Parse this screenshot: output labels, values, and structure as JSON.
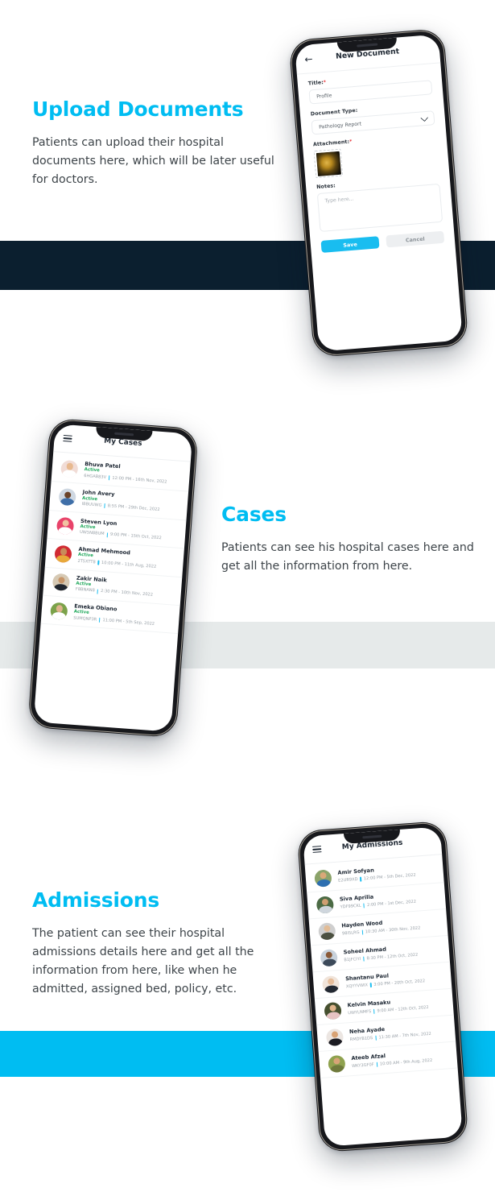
{
  "bands": {
    "dark": "#0b1f2f",
    "gray": "#e6eaea",
    "blue": "#00bdf2",
    "accent": "#00bdf2",
    "status_green": "#1fa85b"
  },
  "sections": [
    {
      "id": "upload",
      "heading": "Upload Documents",
      "body": "Patients can upload their hospital documents here, which will be later useful for doctors."
    },
    {
      "id": "cases",
      "heading": "Cases",
      "body": "Patients can see his hospital cases here and get all the information from here."
    },
    {
      "id": "admissions",
      "heading": "Admissions",
      "body": "The patient can see their hospital admissions details here and get all the information from here, like when he admitted, assigned bed, policy, etc."
    }
  ],
  "new_document": {
    "appbar": {
      "title": "New Document",
      "back_icon": "arrow-left-icon"
    },
    "title_label": "Title:",
    "title_required": "*",
    "title_value": "Profile",
    "doctype_label": "Document Type:",
    "doctype_value": "Pathology Report",
    "doctype_caret": "chevron-down-icon",
    "attachment_label": "Attachment:",
    "attachment_required": "*",
    "notes_label": "Notes:",
    "notes_placeholder": "Type here...",
    "save_label": "Save",
    "cancel_label": "Cancel"
  },
  "cases": {
    "appbar": {
      "title": "My Cases",
      "menu_icon": "hamburger-menu-icon"
    },
    "rows": [
      {
        "name": "Bhuva Patel",
        "status": "Active",
        "code": "6HGAB83V",
        "time": "12:00 PM",
        "date": "16th Nov, 2022",
        "skin": "#e8b98f",
        "shirt": "#ffffff",
        "bg": "#f1dcd6"
      },
      {
        "name": "John Avery",
        "status": "Active",
        "code": "IBBUUWG",
        "time": "8:55 PM",
        "date": "29th Dec, 2022",
        "skin": "#6b4328",
        "shirt": "#3f6fa8",
        "bg": "#cfd8e2"
      },
      {
        "name": "Steven Lyon",
        "status": "Active",
        "code": "UW5N8BUM",
        "time": "9:00 PM",
        "date": "15th Oct, 2022",
        "skin": "#f0c3a2",
        "shirt": "#ffffff",
        "bg": "#e8436a"
      },
      {
        "name": "Ahmad Mehmood",
        "status": "Active",
        "code": "2T5XTT8",
        "time": "10:00 PM",
        "date": "11th Aug, 2022",
        "skin": "#c98b5a",
        "shirt": "#e8a93a",
        "bg": "#d12a32"
      },
      {
        "name": "Zakir Naik",
        "status": "Active",
        "code": "F8BNAN8",
        "time": "2:30 PM",
        "date": "10th Nov, 2022",
        "skin": "#c79568",
        "shirt": "#21262e",
        "bg": "#d6c9b4"
      },
      {
        "name": "Emeka Obiano",
        "status": "Active",
        "code": "SUMQNP3R",
        "time": "11:00 PM",
        "date": "5th Sep, 2022",
        "skin": "#dfb38c",
        "shirt": "#ffffff",
        "bg": "#7ba24a"
      }
    ]
  },
  "admissions": {
    "appbar": {
      "title": "My Admissions",
      "menu_icon": "hamburger-menu-icon"
    },
    "rows": [
      {
        "name": "Amir Sofyan",
        "code": "E2UR9XD",
        "time": "12:00 PM",
        "date": "5th Dec, 2022",
        "skin": "#d9a878",
        "shirt": "#2e6fb0",
        "bg": "#8ba36a"
      },
      {
        "name": "Siva Aprilia",
        "code": "YDF99CKL",
        "time": "2:00 PM",
        "date": "1st Dec, 2022",
        "skin": "#cf9f72",
        "shirt": "#cfd6dd",
        "bg": "#4c6b45"
      },
      {
        "name": "Hayden Wood",
        "code": "98I5LRG",
        "time": "10:30 AM",
        "date": "30th Nov, 2022",
        "skin": "#e2bc96",
        "shirt": "#4b5040",
        "bg": "#cfcfcf"
      },
      {
        "name": "Soheel Ahmad",
        "code": "B1JFCIYI",
        "time": "8:30 PM",
        "date": "12th Oct, 2022",
        "skin": "#8a5a38",
        "shirt": "#3d4a5a",
        "bg": "#c8d2dc"
      },
      {
        "name": "Shantanu Paul",
        "code": "XQYYVWIX",
        "time": "3:00 PM",
        "date": "20th Oct, 2022",
        "skin": "#e6bd9a",
        "shirt": "#232932",
        "bg": "#f0e4da"
      },
      {
        "name": "Kelvin Masaku",
        "code": "UWYLNMFS",
        "time": "9:00 AM",
        "date": "12th Oct, 2022",
        "skin": "#e0b58c",
        "shirt": "#e7c3c3",
        "bg": "#46502f"
      },
      {
        "name": "Neha Ayade",
        "code": "RMDYB1DS",
        "time": "11:30 AM",
        "date": "7th Nov, 2022",
        "skin": "#d8a274",
        "shirt": "#1b1b22",
        "bg": "#ece6e2"
      },
      {
        "name": "Ateeb Afzal",
        "code": "WKY3GF0F",
        "time": "10:00 AM",
        "date": "9th Aug, 2022",
        "skin": "#d7a477",
        "shirt": "#6f7a3c",
        "bg": "#8fa24f"
      }
    ]
  }
}
